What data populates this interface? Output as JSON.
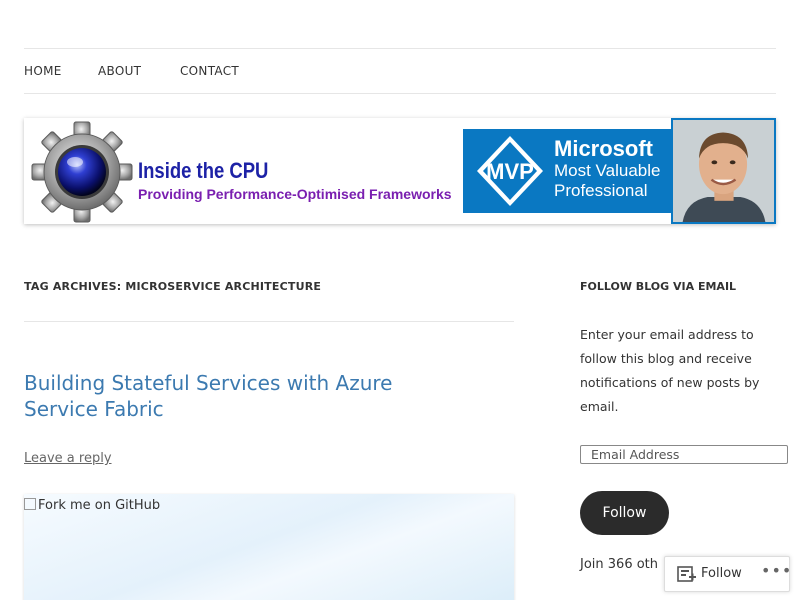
{
  "nav": {
    "items": [
      {
        "label": "HOME"
      },
      {
        "label": "ABOUT"
      },
      {
        "label": "CONTACT"
      }
    ]
  },
  "banner": {
    "title": "Inside the CPU",
    "tagline": "Providing Performance-Optimised Frameworks",
    "mvp": {
      "badge": "MVP",
      "line1": "Microsoft",
      "line2": "Most Valuable",
      "line3": "Professional"
    }
  },
  "archive": {
    "heading": "TAG ARCHIVES: MICROSERVICE ARCHITECTURE"
  },
  "post": {
    "title": "Building Stateful Services with Azure Service Fabric",
    "reply_link": "Leave a reply",
    "image_alt": "Fork me on GitHub"
  },
  "sidebar": {
    "widget_title": "FOLLOW BLOG VIA EMAIL",
    "description": "Enter your email address to follow this blog and receive notifications of new posts by email.",
    "email_placeholder": "Email Address",
    "follow_button": "Follow",
    "join_text": "Join 366 oth"
  },
  "follow_bar": {
    "label": "Follow",
    "more": "•••"
  },
  "colors": {
    "link": "#3c7ab0",
    "mvp_blue": "#0a78c2",
    "title_blue": "#1d22a6",
    "tagline_purple": "#7a1fb0",
    "button_dark": "#2b2b2b"
  }
}
